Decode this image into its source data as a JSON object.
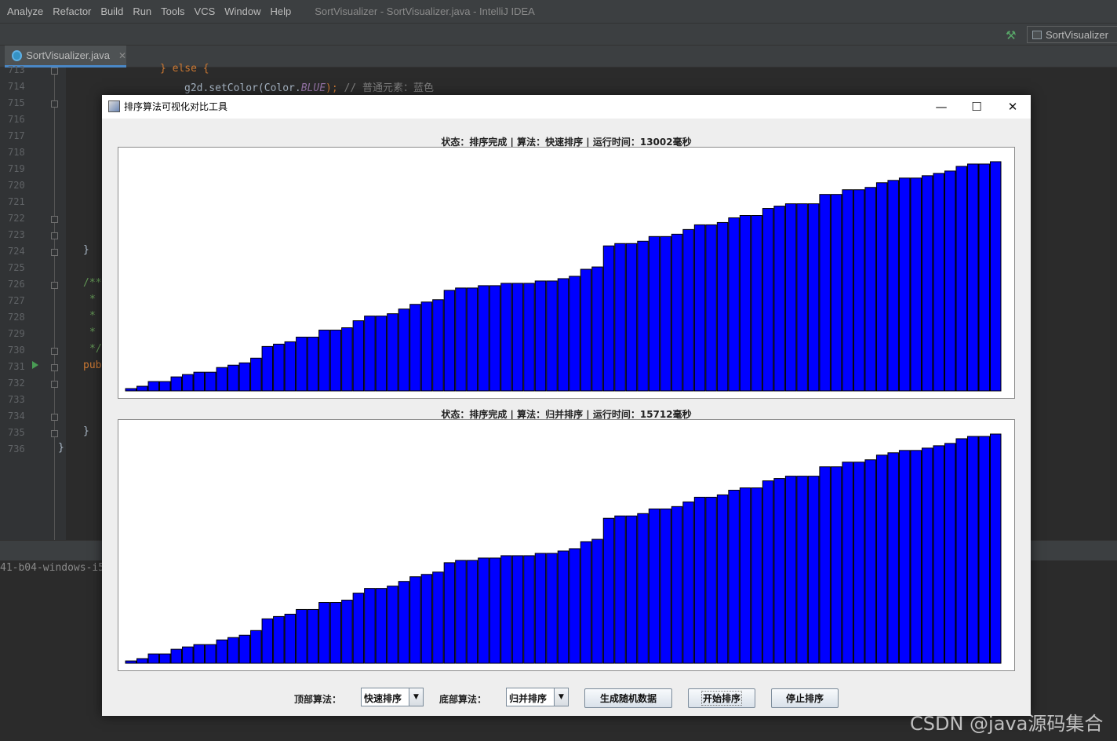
{
  "ide": {
    "menu": [
      "Analyze",
      "Refactor",
      "Build",
      "Run",
      "Tools",
      "VCS",
      "Window",
      "Help"
    ],
    "title": "SortVisualizer - SortVisualizer.java - IntelliJ IDEA",
    "run_config": "SortVisualizer",
    "tab_file": "SortVisualizer.java",
    "line_numbers": [
      "713",
      "714",
      "715",
      "716",
      "717",
      "718",
      "719",
      "720",
      "721",
      "722",
      "723",
      "724",
      "725",
      "726",
      "727",
      "728",
      "729",
      "730",
      "731",
      "732",
      "733",
      "734",
      "735",
      "736"
    ],
    "code": {
      "l713_kw": "} else {",
      "l714_call": "g2d.setColor(Color.",
      "l714_field": "BLUE",
      "l714_end": ");",
      "l714_comment": "// 普通元素：蓝色",
      "l724": "}",
      "l726": "/**",
      "l727": "*",
      "l728": "*",
      "l729": "*",
      "l730": "*/",
      "l731": "pub",
      "l735": "}",
      "l736": "}"
    },
    "console_text": "41-b04-windows-i5"
  },
  "window": {
    "title": "排序算法可视化对比工具",
    "minimize_glyph": "—",
    "maximize_glyph": "☐",
    "close_glyph": "✕"
  },
  "top_status": "状态：排序完成 | 算法：快速排序 | 运行时间：13002毫秒",
  "bottom_status": "状态：排序完成 | 算法：归并排序 | 运行时间：15712毫秒",
  "controls": {
    "top_label": "顶部算法：",
    "top_value": "快速排序",
    "bottom_label": "底部算法：",
    "bottom_value": "归并排序",
    "generate_button": "生成随机数据",
    "start_button": "开始排序",
    "stop_button": "停止排序",
    "dropdown_glyph": "▼"
  },
  "colors": {
    "bar_fill": "#0000ff",
    "bar_stroke": "#000000"
  },
  "chart_data": {
    "type": "bar",
    "ylim": [
      0,
      100
    ],
    "values": [
      1,
      2,
      4,
      4,
      6,
      7,
      8,
      8,
      10,
      11,
      12,
      14,
      19,
      20,
      21,
      23,
      23,
      26,
      26,
      27,
      30,
      32,
      32,
      33,
      35,
      37,
      38,
      39,
      43,
      44,
      44,
      45,
      45,
      46,
      46,
      46,
      47,
      47,
      48,
      49,
      52,
      53,
      62,
      63,
      63,
      64,
      66,
      66,
      67,
      69,
      71,
      71,
      72,
      74,
      75,
      75,
      78,
      79,
      80,
      80,
      80,
      84,
      84,
      86,
      86,
      87,
      89,
      90,
      91,
      91,
      92,
      93,
      94,
      96,
      97,
      97,
      98
    ]
  }
}
